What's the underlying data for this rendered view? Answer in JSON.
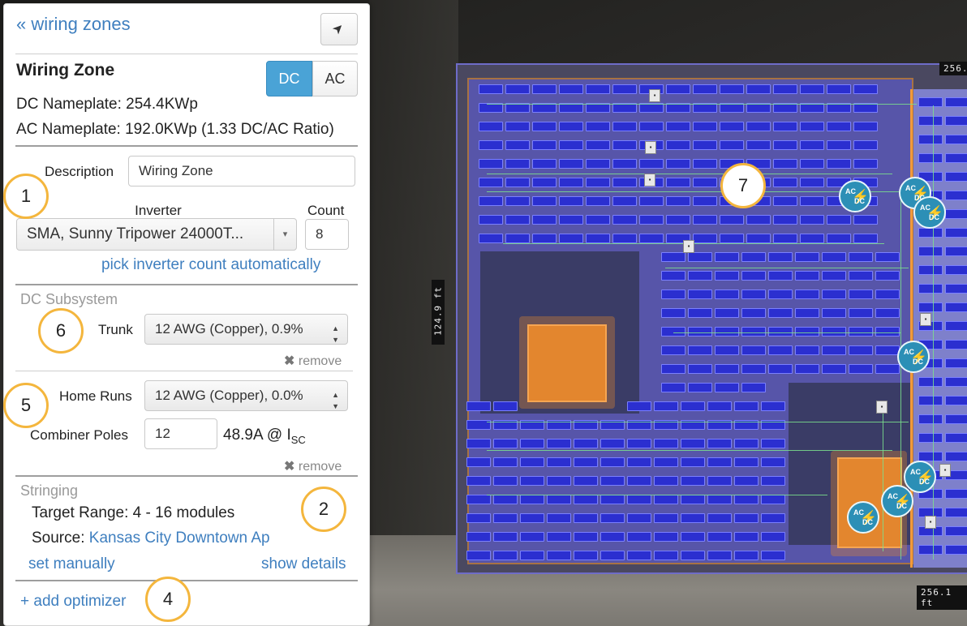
{
  "panel": {
    "back_link": "« wiring zones",
    "locate_icon": "➤",
    "title": "Wiring Zone",
    "toggle": {
      "dc": "DC",
      "ac": "AC",
      "selected": "DC"
    },
    "dc_nameplate": "DC Nameplate: 254.4KWp",
    "ac_nameplate": "AC Nameplate: 192.0KWp (1.33 DC/AC Ratio)",
    "description": {
      "label": "Description",
      "value": "Wiring Zone"
    },
    "inverter": {
      "label": "Inverter",
      "value": "SMA, Sunny Tripower 24000T...",
      "caret": "▾"
    },
    "count": {
      "label": "Count",
      "value": "8"
    },
    "pick_auto": "pick inverter count automatically",
    "dc_subsystem": {
      "title": "DC Subsystem",
      "trunk": {
        "label": "Trunk",
        "value": "12 AWG (Copper), 0.9%",
        "caret": "▲▼"
      },
      "trunk_remove": "remove",
      "home_runs": {
        "label": "Home Runs",
        "value": "12 AWG (Copper), 0.0%",
        "caret": "▲▼"
      },
      "combiner_poles": {
        "label": "Combiner Poles",
        "value": "12"
      },
      "isc_text": "48.9A @ I",
      "isc_sub": "SC",
      "home_runs_remove": "remove",
      "remove_icon": "✖"
    },
    "stringing": {
      "title": "Stringing",
      "target_range": "Target Range: 4 - 16 modules",
      "source_label": "Source: ",
      "source_link": "Kansas City Downtown Ap",
      "set_manually": "set manually",
      "show_details": "show details"
    },
    "add_optimizer": "+ add optimizer"
  },
  "callouts": [
    "1",
    "2",
    "4",
    "5",
    "6",
    "7"
  ],
  "map": {
    "dim_top": "256.",
    "dim_bottom": "256.1 ft",
    "dim_side": "124.9 ft",
    "inverter_icon": {
      "top": "AC",
      "bottom": "DC",
      "bolt": "⚡"
    },
    "combiner_glyph": "▪"
  },
  "colors": {
    "accent": "#4aa3d6",
    "link": "#3f7fbf",
    "callout_border": "#f4b63d",
    "panel_blue": "#2b2fd0",
    "obstacle": "#e3862e",
    "wire": "#7be08d"
  }
}
